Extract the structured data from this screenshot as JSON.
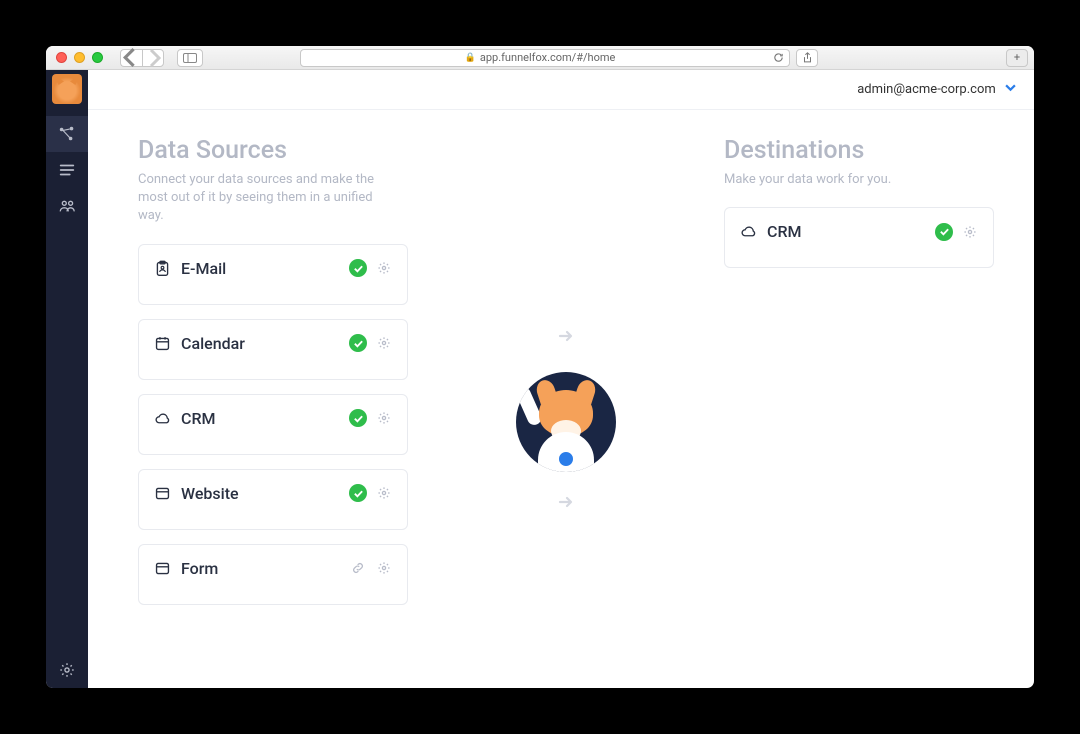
{
  "browser": {
    "url": "app.funnelfox.com/#/home"
  },
  "header": {
    "user_email": "admin@acme-corp.com"
  },
  "sources": {
    "title": "Data Sources",
    "subtitle": "Connect your data sources and make the most out of it by seeing them in a unified way.",
    "items": [
      {
        "label": "E-Mail",
        "icon": "clipboard-icon",
        "status": "ok"
      },
      {
        "label": "Calendar",
        "icon": "calendar-icon",
        "status": "ok"
      },
      {
        "label": "CRM",
        "icon": "cloud-icon",
        "status": "ok"
      },
      {
        "label": "Website",
        "icon": "window-icon",
        "status": "ok"
      },
      {
        "label": "Form",
        "icon": "window-icon",
        "status": "link"
      }
    ]
  },
  "destinations": {
    "title": "Destinations",
    "subtitle": "Make your data work for you.",
    "items": [
      {
        "label": "CRM",
        "icon": "cloud-icon",
        "status": "ok"
      }
    ]
  }
}
